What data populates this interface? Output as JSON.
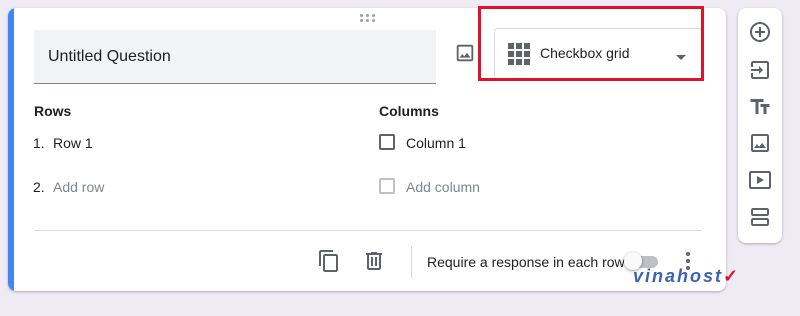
{
  "question": {
    "title": "Untitled Question",
    "type_label": "Checkbox grid"
  },
  "rows": {
    "heading": "Rows",
    "items": [
      {
        "num": "1.",
        "label": "Row 1"
      }
    ],
    "add": {
      "num": "2.",
      "label": "Add row"
    }
  },
  "columns": {
    "heading": "Columns",
    "items": [
      {
        "label": "Column 1"
      }
    ],
    "add": {
      "label": "Add column"
    }
  },
  "footer": {
    "require_label": "Require a response in each row",
    "require_on": false
  },
  "watermark": {
    "text": "vinahost",
    "mark": "✓"
  },
  "colors": {
    "accent": "#4285f4",
    "highlight": "#e0112b"
  }
}
